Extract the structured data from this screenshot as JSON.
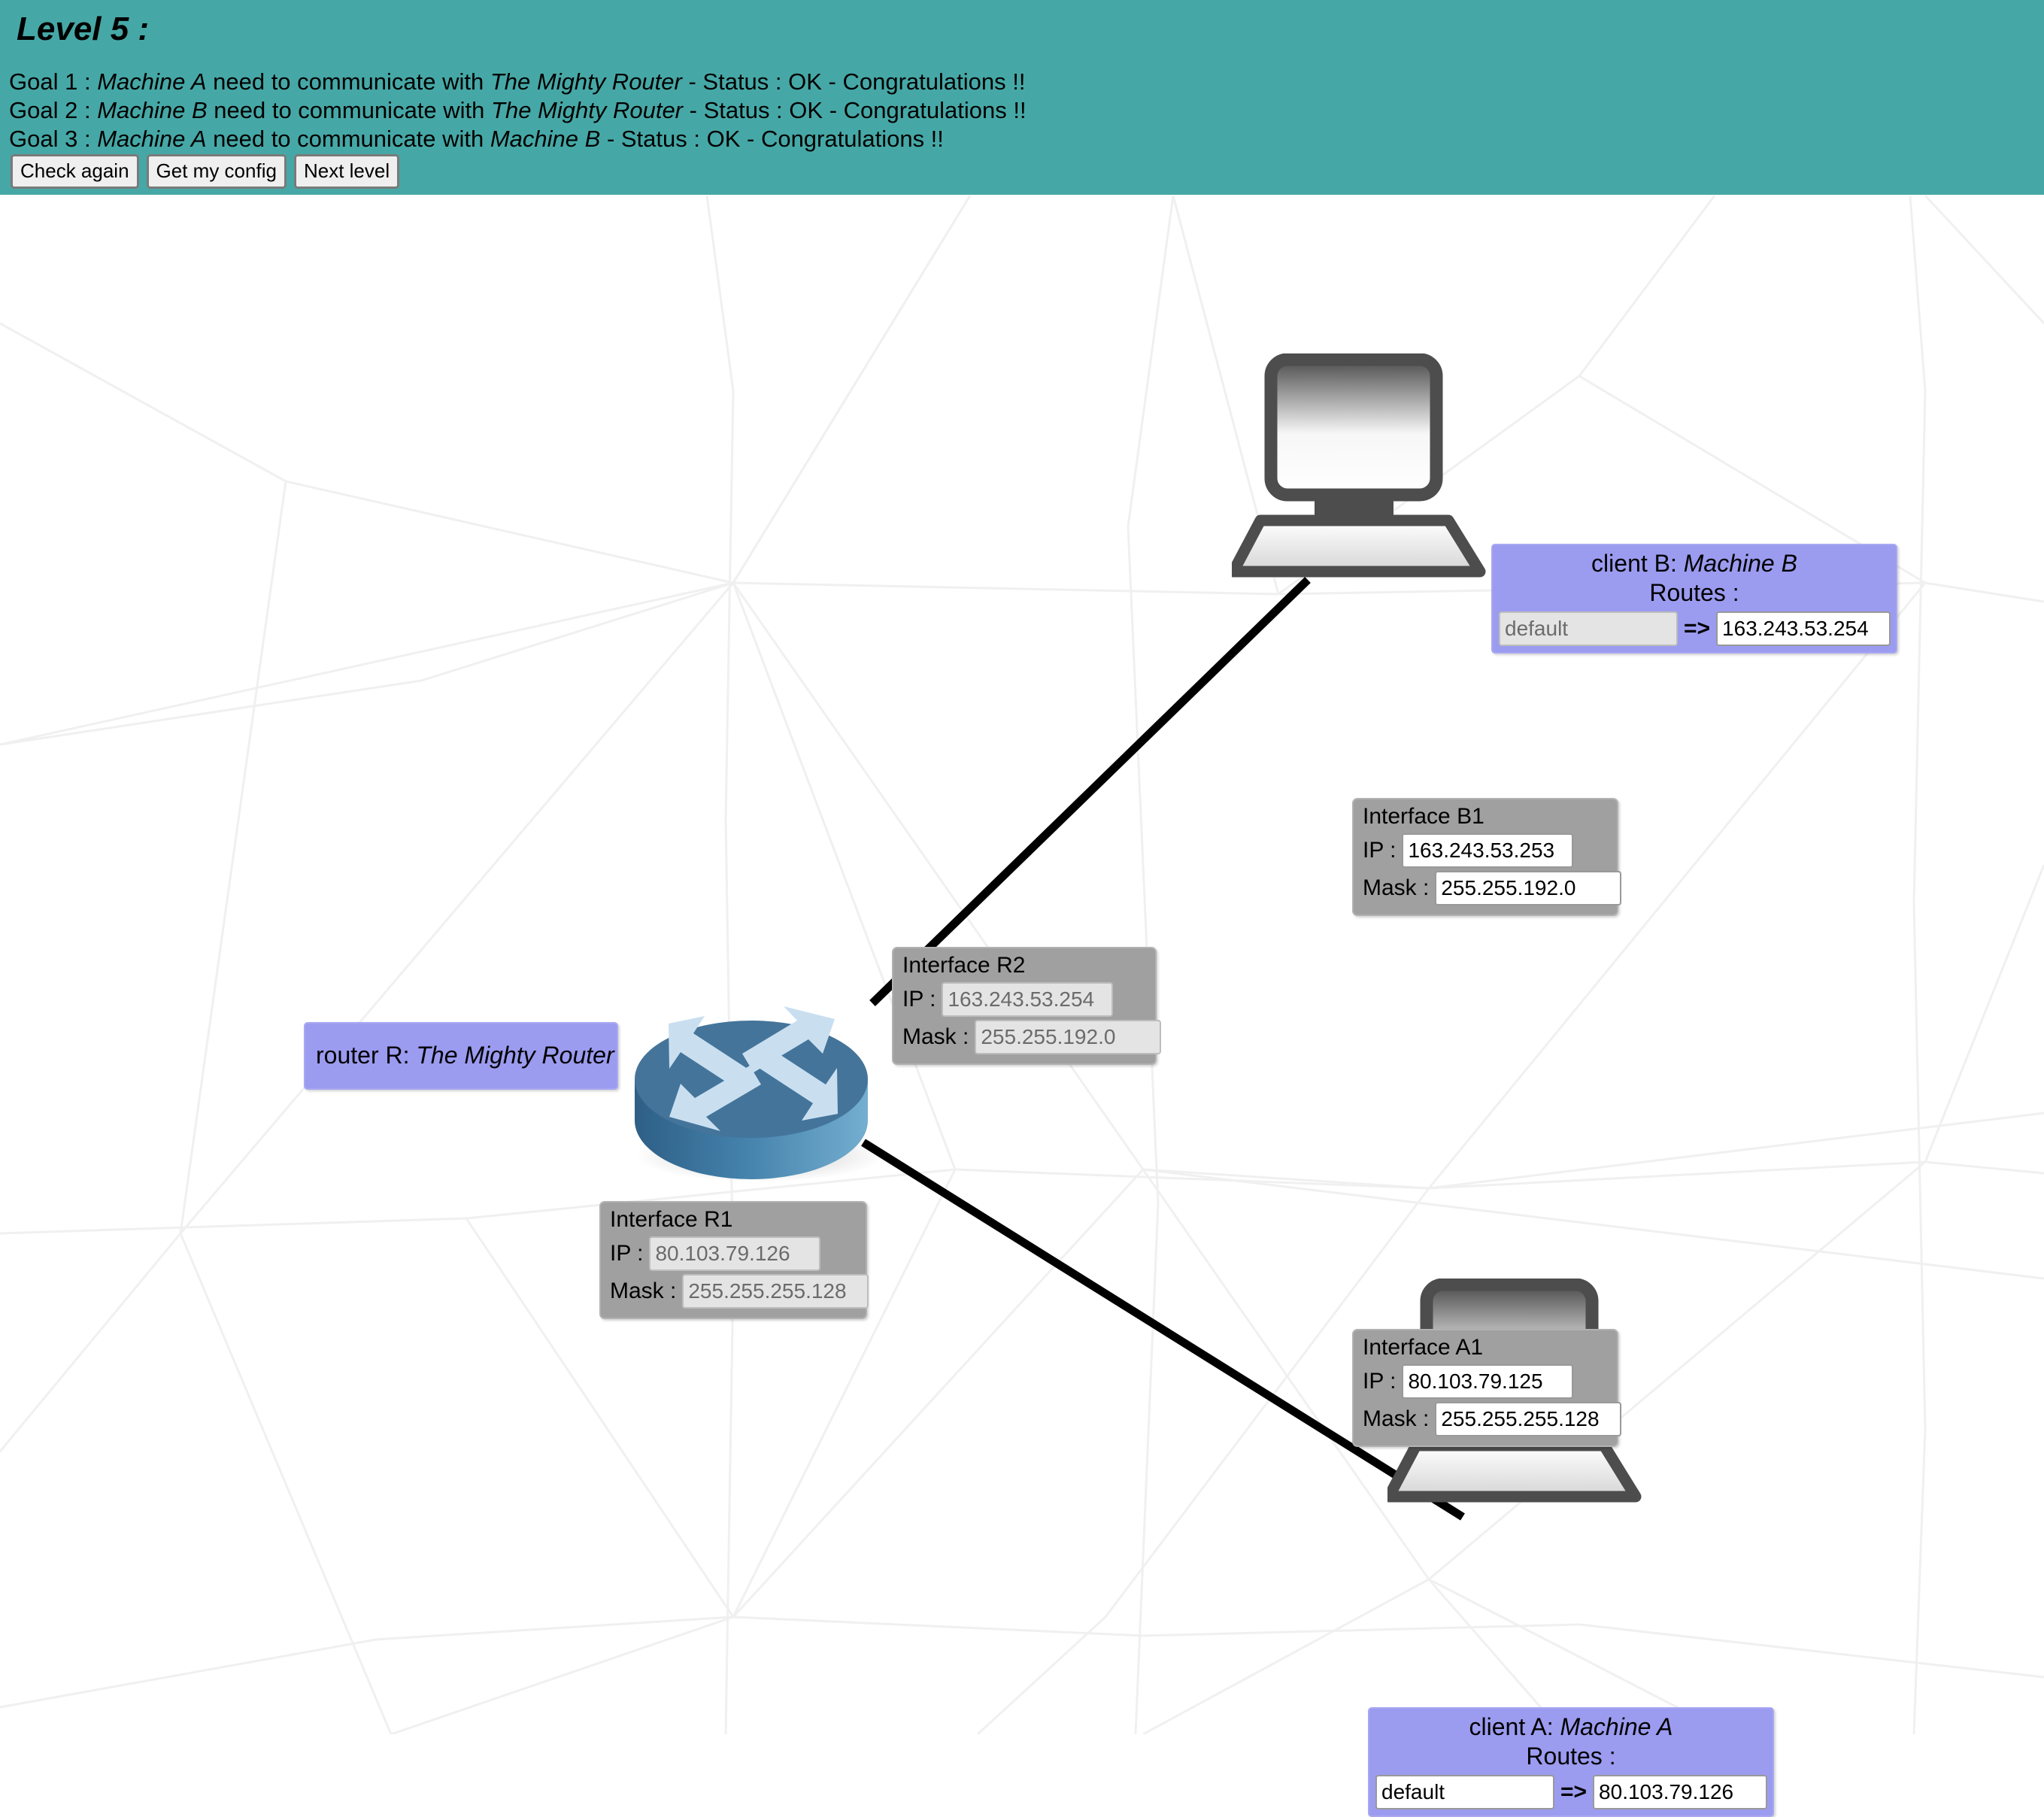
{
  "header": {
    "title": "Level 5 :",
    "goals": [
      {
        "prefix": "Goal 1 : ",
        "subject": "Machine A",
        "middle": " need to communicate with ",
        "target": "The Mighty Router",
        "suffix": " - Status : OK - Congratulations !!"
      },
      {
        "prefix": "Goal 2 : ",
        "subject": "Machine B",
        "middle": " need to communicate with ",
        "target": "The Mighty Router",
        "suffix": " - Status : OK - Congratulations !!"
      },
      {
        "prefix": "Goal 3 : ",
        "subject": "Machine A",
        "middle": " need to communicate with ",
        "target": "Machine B",
        "suffix": " - Status : OK - Congratulations !!"
      }
    ],
    "buttons": [
      {
        "label": "Check again"
      },
      {
        "label": "Get my config"
      },
      {
        "label": "Next level"
      }
    ],
    "background_color": "#46a8a6"
  },
  "nodes": {
    "client_b": {
      "title_prefix": "client B: ",
      "title_name": "Machine B",
      "routes_label": "Routes :",
      "route": {
        "destination": "default",
        "arrow": "=>",
        "gateway": "163.243.53.254",
        "destination_disabled": true,
        "gateway_disabled": false
      },
      "panel_color": "#9b9bf0",
      "icon": "desktop-computer-icon"
    },
    "client_a": {
      "title_prefix": "client A: ",
      "title_name": "Machine A",
      "routes_label": "Routes :",
      "route": {
        "destination": "default",
        "arrow": "=>",
        "gateway": "80.103.79.126",
        "destination_disabled": false,
        "gateway_disabled": false
      },
      "panel_color": "#9b9bf0",
      "icon": "desktop-computer-icon"
    },
    "router": {
      "title_prefix": "router R: ",
      "title_name": "The Mighty Router",
      "panel_color": "#9b9bf0",
      "icon": "router-icon"
    }
  },
  "interfaces": [
    {
      "id": "b1",
      "title": "Interface B1",
      "ip_label": "IP :",
      "ip_value": "163.243.53.253",
      "ip_disabled": false,
      "mask_label": "Mask :",
      "mask_value": "255.255.192.0",
      "mask_disabled": false,
      "box_color": "#a0a0a0"
    },
    {
      "id": "r2",
      "title": "Interface R2",
      "ip_label": "IP :",
      "ip_value": "163.243.53.254",
      "ip_disabled": true,
      "mask_label": "Mask :",
      "mask_value": "255.255.192.0",
      "mask_disabled": true,
      "box_color": "#a0a0a0"
    },
    {
      "id": "r1",
      "title": "Interface R1",
      "ip_label": "IP :",
      "ip_value": "80.103.79.126",
      "ip_disabled": true,
      "mask_label": "Mask :",
      "mask_value": "255.255.255.128",
      "mask_disabled": true,
      "box_color": "#a0a0a0"
    },
    {
      "id": "a1",
      "title": "Interface A1",
      "ip_label": "IP :",
      "ip_value": "80.103.79.125",
      "ip_disabled": false,
      "mask_label": "Mask :",
      "mask_value": "255.255.255.128",
      "mask_disabled": false,
      "box_color": "#a0a0a0"
    }
  ],
  "links": [
    {
      "from": "router",
      "to": "client_b"
    },
    {
      "from": "router",
      "to": "client_a"
    }
  ]
}
